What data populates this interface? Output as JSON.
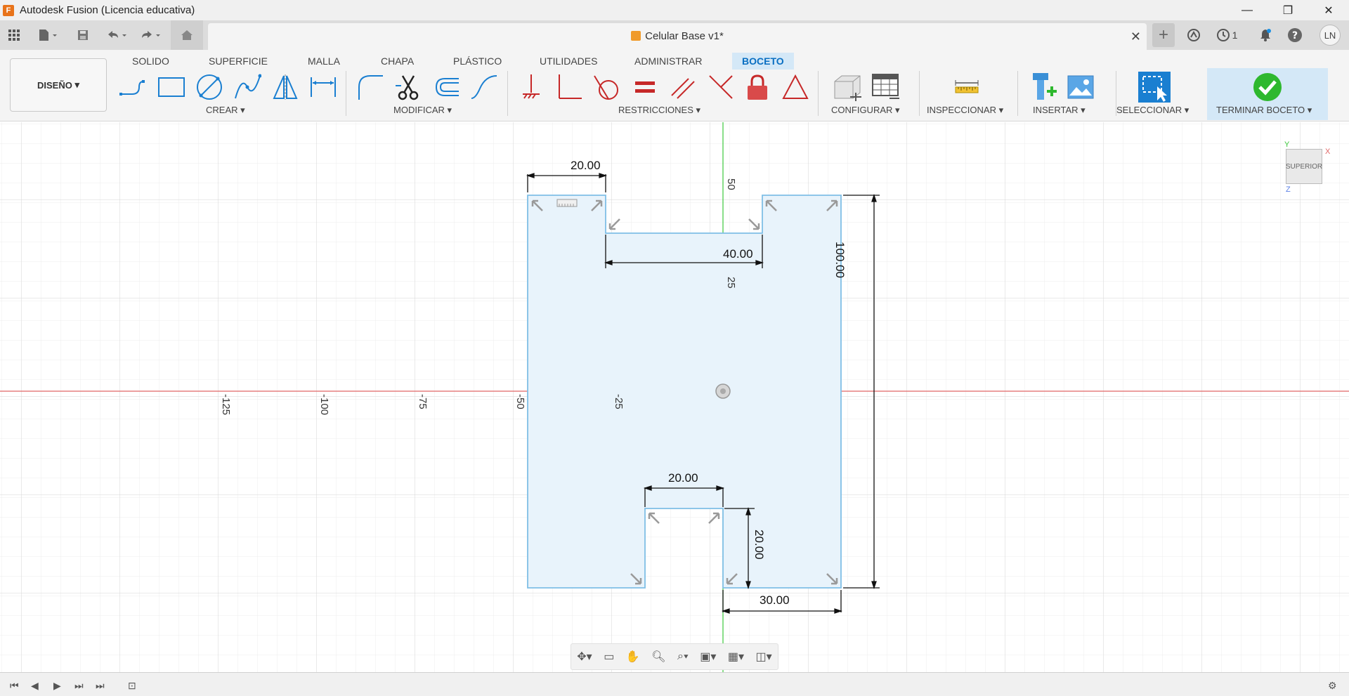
{
  "window": {
    "title": "Autodesk Fusion (Licencia educativa)",
    "logo": "F",
    "minimize": "—",
    "restore": "❐",
    "close": "✕"
  },
  "document": {
    "title": "Celular Base v1*",
    "close": "✕",
    "jobs_count": "1",
    "user_initials": "LN"
  },
  "workspace": {
    "label": "DISEÑO",
    "arrow": "▾"
  },
  "ribbon_tabs": [
    "SOLIDO",
    "SUPERFICIE",
    "MALLA",
    "CHAPA",
    "PLÁSTICO",
    "UTILIDADES",
    "ADMINISTRAR",
    "BOCETO"
  ],
  "active_tab": "BOCETO",
  "groups": {
    "create": "CREAR ▾",
    "modify": "MODIFICAR ▾",
    "constraints": "RESTRICCIONES ▾",
    "configure": "CONFIGURAR ▾",
    "inspect": "INSPECCIONAR ▾",
    "insert": "INSERTAR ▾",
    "select": "SELECCIONAR ▾",
    "finish": "TERMINAR BOCETO ▾"
  },
  "axis_labels": {
    "x": [
      "-125",
      "-100",
      "-75",
      "-50",
      "-25"
    ],
    "y": [
      "50",
      "25"
    ]
  },
  "dimensions": {
    "top_left_width": "20.00",
    "top_notch_width": "40.00",
    "total_height": "100.00",
    "bottom_notch_width": "20.00",
    "bottom_notch_height": "20.00",
    "bottom_right_width": "30.00"
  },
  "viewcube": {
    "face": "SUPERIOR",
    "x": "X",
    "y": "Y",
    "z": "Z"
  },
  "colors": {
    "x_axis": "#e06666",
    "y_axis": "#3cc83c",
    "sketch_fill": "#e8f3fb",
    "sketch_line": "#7fbfe6",
    "accent": "#0a6fc2",
    "finish": "#2eb82e"
  }
}
